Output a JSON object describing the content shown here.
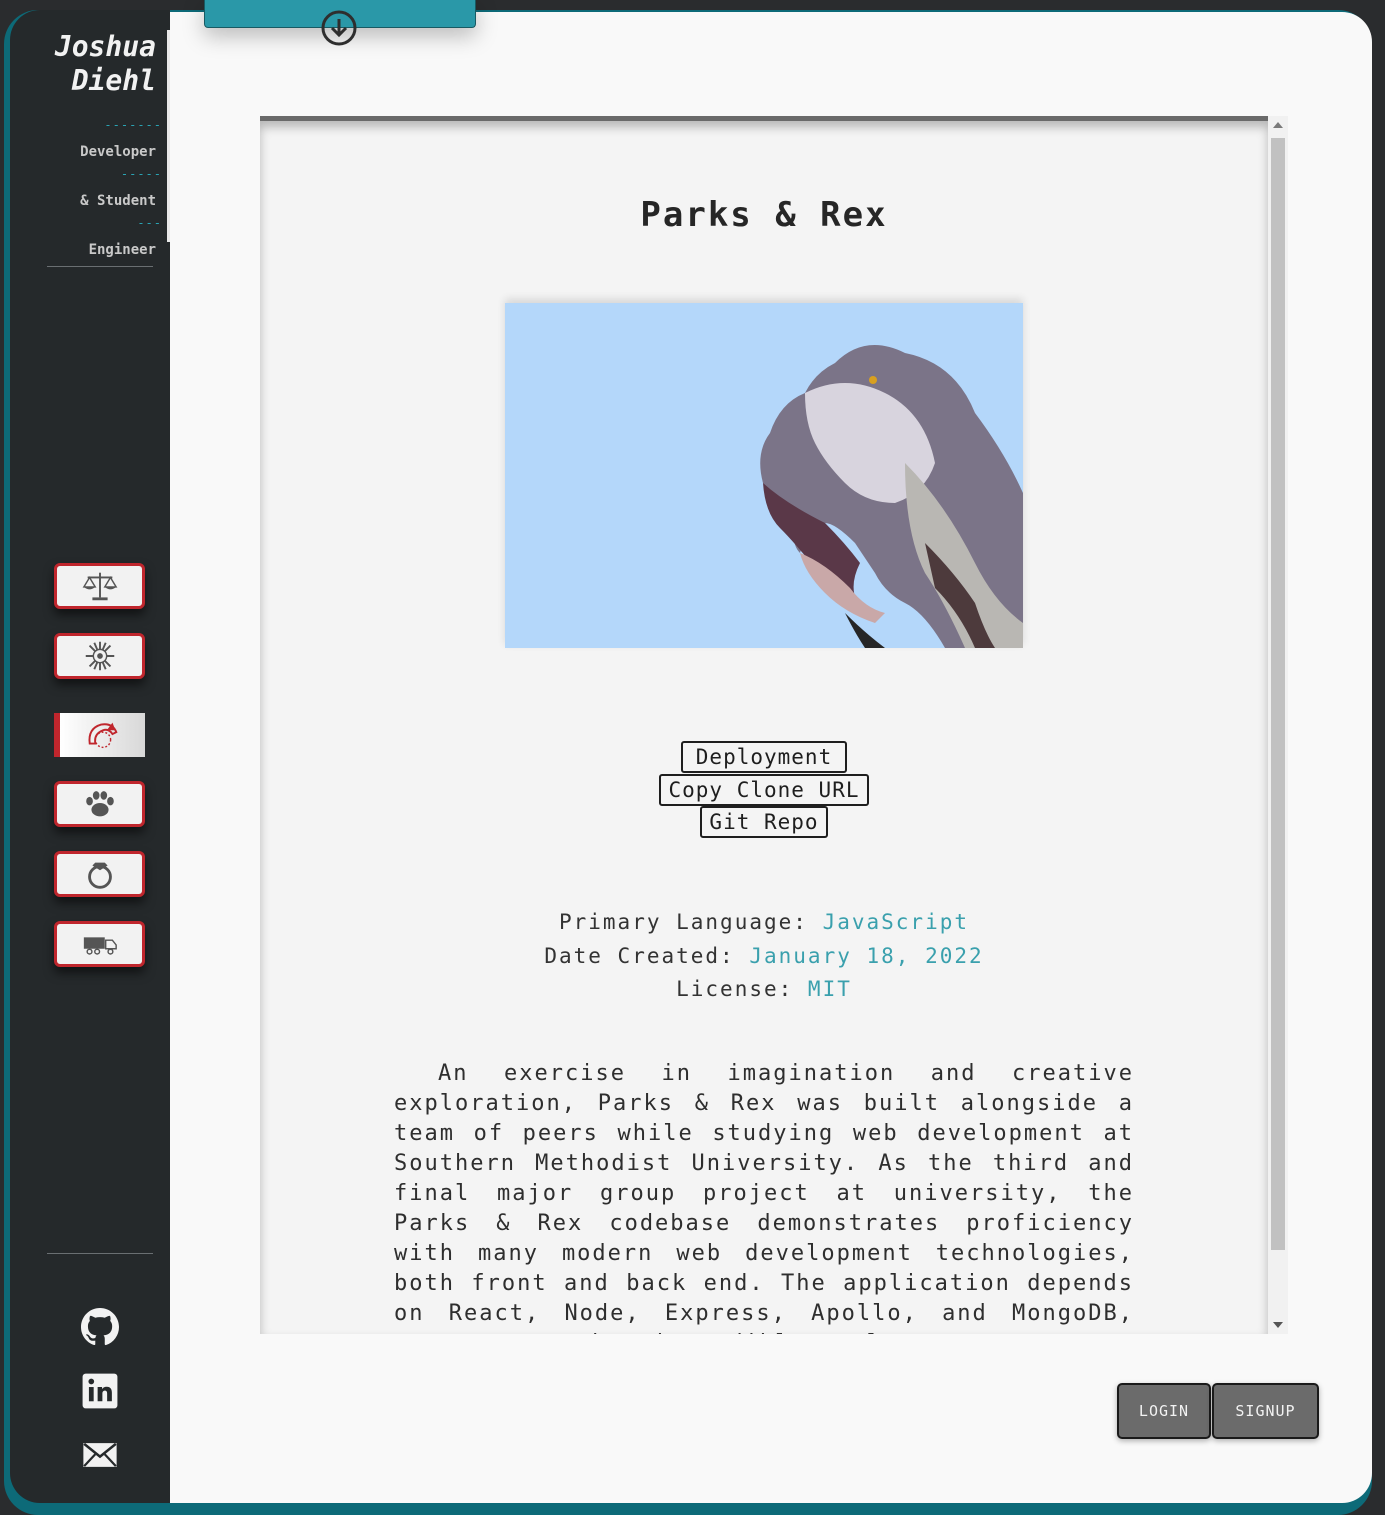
{
  "brand": {
    "first_name": "Joshua",
    "last_name": "Diehl",
    "roles": [
      "Developer",
      "& Student",
      "Engineer"
    ],
    "role_dashes": [
      "-------",
      "-----",
      "---"
    ]
  },
  "sidebar": {
    "projects": [
      {
        "icon": "scales-icon",
        "active": false
      },
      {
        "icon": "sunburst-icon",
        "active": false
      },
      {
        "icon": "dinosaur-icon",
        "active": true
      },
      {
        "icon": "paw-icon",
        "active": false
      },
      {
        "icon": "ring-icon",
        "active": false
      },
      {
        "icon": "truck-icon",
        "active": false
      }
    ],
    "social": [
      "github-icon",
      "linkedin-icon",
      "email-icon"
    ]
  },
  "project": {
    "title": "Parks & Rex",
    "buttons": {
      "deployment": "Deployment",
      "clone": "Copy Clone URL",
      "repo": "Git Repo"
    },
    "meta": {
      "language_label": "Primary Language: ",
      "language_value": "JavaScript",
      "date_label": "Date Created: ",
      "date_value": "January 18, 2022",
      "license_label": "License: ",
      "license_value": "MIT"
    },
    "description": "An exercise in imagination and creative exploration, Parks & Rex was built alongside a team of peers while studying web development at Southern Methodist University. As the third and final major group project at university, the Parks & Rex codebase demonstrates proficiency with many modern web development technologies, both front and back end. The application depends on React, Node, Express, Apollo, and MongoDB, among many other incredible tools."
  },
  "auth": {
    "login": "LOGIN",
    "signup": "SIGNUP"
  },
  "colors": {
    "accent": "#2a98a8",
    "link": "#3aa0ad",
    "button_border": "#c0262d",
    "sidebar": "#25292b"
  }
}
